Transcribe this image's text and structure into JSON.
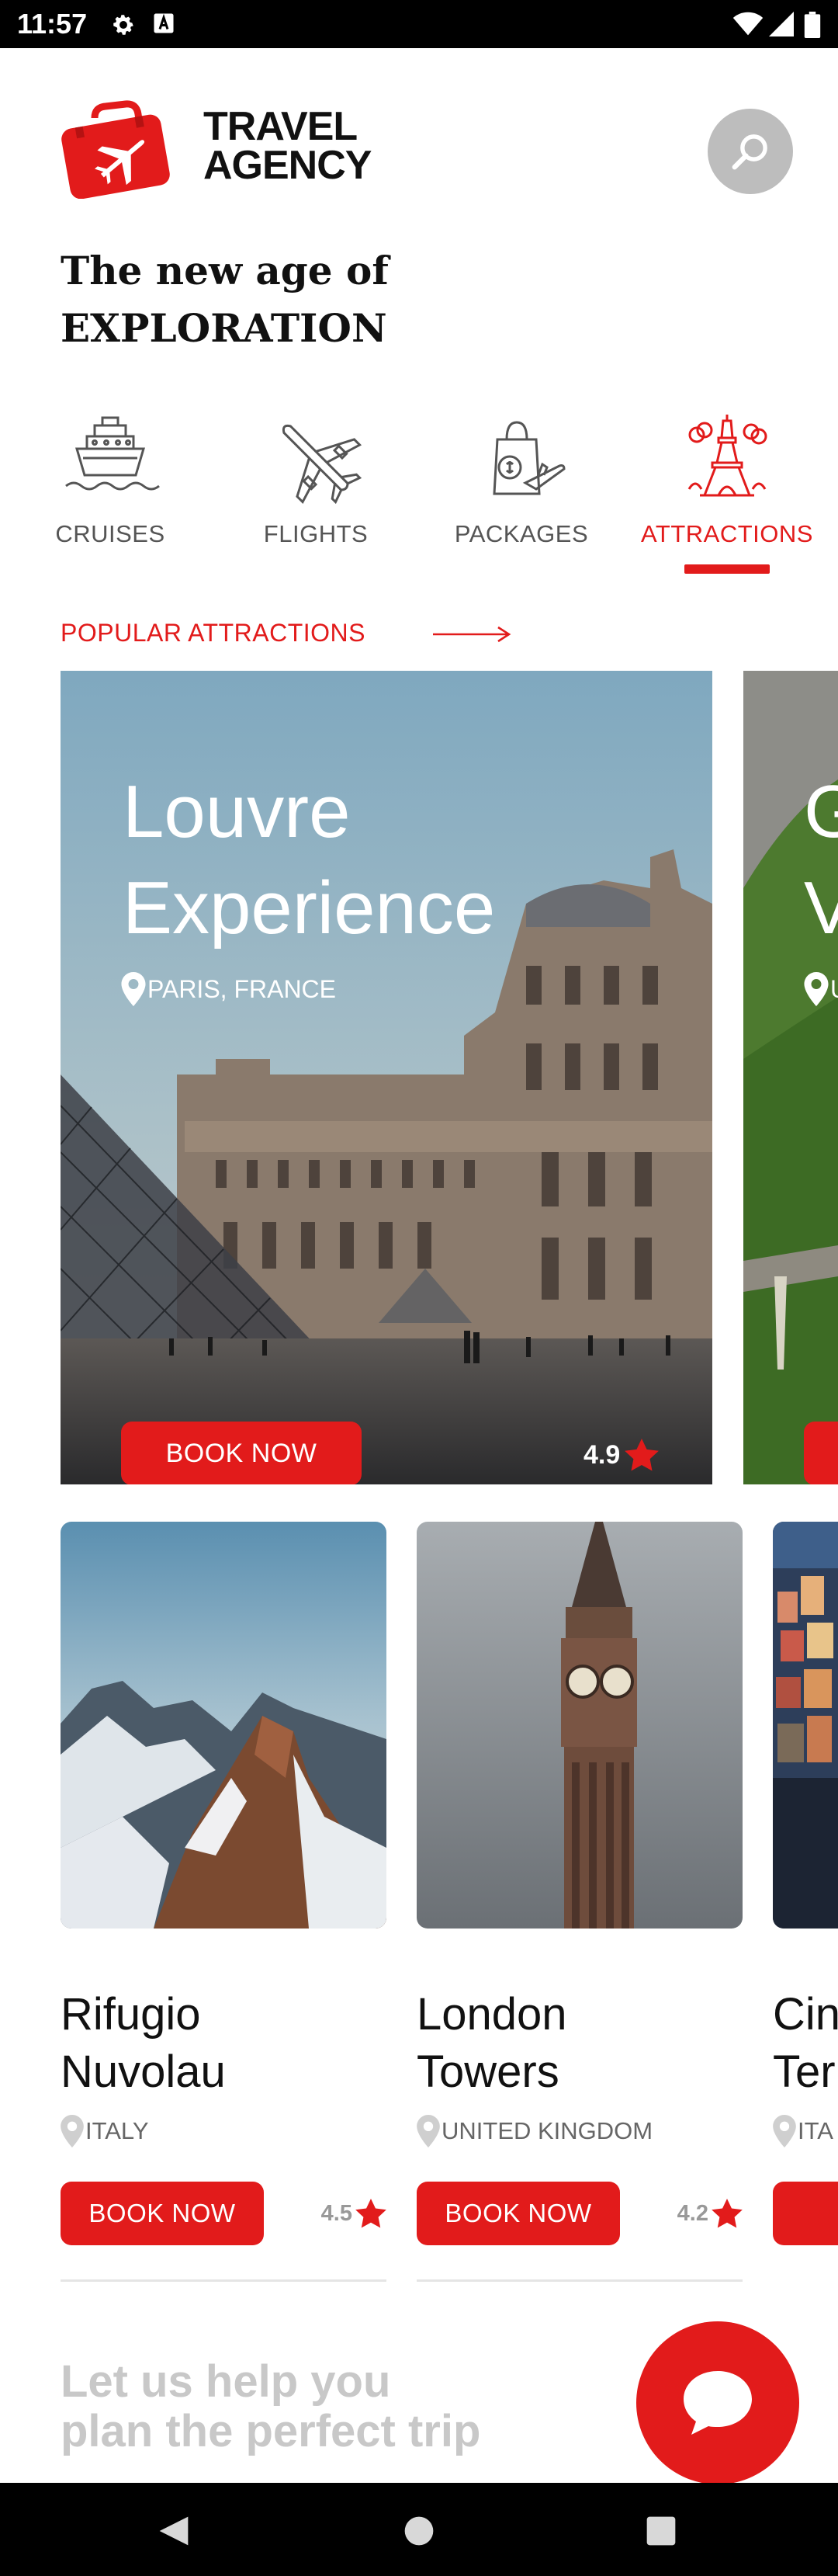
{
  "status": {
    "time": "11:57"
  },
  "brand": {
    "line1": "TRAVEL",
    "line2": "AGENCY"
  },
  "tagline": {
    "line1": "The new age of",
    "line2": "EXPLORATION"
  },
  "categories": [
    {
      "label": "CRUISES",
      "icon": "cruise-ship-icon",
      "active": false
    },
    {
      "label": "FLIGHTS",
      "icon": "airplane-icon",
      "active": false
    },
    {
      "label": "PACKAGES",
      "icon": "shopping-bag-icon",
      "active": false
    },
    {
      "label": "ATTRACTIONS",
      "icon": "eiffel-tower-icon",
      "active": true
    }
  ],
  "popular": {
    "label": "POPULAR ATTRACTIONS"
  },
  "hero": {
    "title_line1": "Louvre",
    "title_line2": "Experience",
    "location": "PARIS, FRANCE",
    "book_label": "BOOK NOW",
    "rating": "4.9",
    "next_title_fragment1": "G",
    "next_title_fragment2": "V",
    "next_location_fragment": "U"
  },
  "cards": [
    {
      "title_line1": "Rifugio",
      "title_line2": "Nuvolau",
      "location": "ITALY",
      "book_label": "BOOK NOW",
      "rating": "4.5"
    },
    {
      "title_line1": "London",
      "title_line2": "Towers",
      "location": "UNITED KINGDOM",
      "book_label": "BOOK NOW",
      "rating": "4.2"
    },
    {
      "title_line1": "Cin",
      "title_line2": "Ter",
      "location": "ITA",
      "book_label": "BO",
      "rating": ""
    }
  ],
  "help": {
    "line1": "Let us help you",
    "line2": "plan the perfect trip"
  },
  "colors": {
    "accent": "#e21b1b",
    "status_bar": "#000000",
    "search_bg": "#bdbdbd"
  }
}
